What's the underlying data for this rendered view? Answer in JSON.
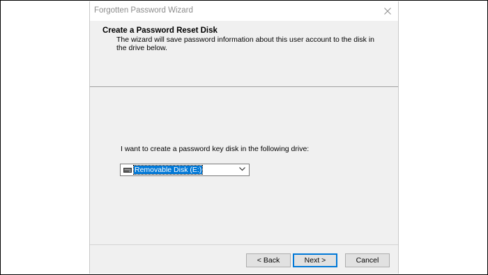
{
  "window": {
    "title": "Forgotten Password Wizard",
    "close_icon": "close-icon"
  },
  "header": {
    "heading": "Create a Password Reset Disk",
    "description": "The wizard will save password information about this user account to the disk in the drive below."
  },
  "body": {
    "prompt": "I want to create a password key disk in the following drive:",
    "drive_select": {
      "selected": "Removable Disk (E:)",
      "icon": "drive-icon"
    }
  },
  "buttons": {
    "back": "< Back",
    "next": "Next >",
    "cancel": "Cancel"
  },
  "colors": {
    "accent": "#0078d7",
    "title_text": "#8c8c8c",
    "window_bg": "#f0f0f0"
  }
}
